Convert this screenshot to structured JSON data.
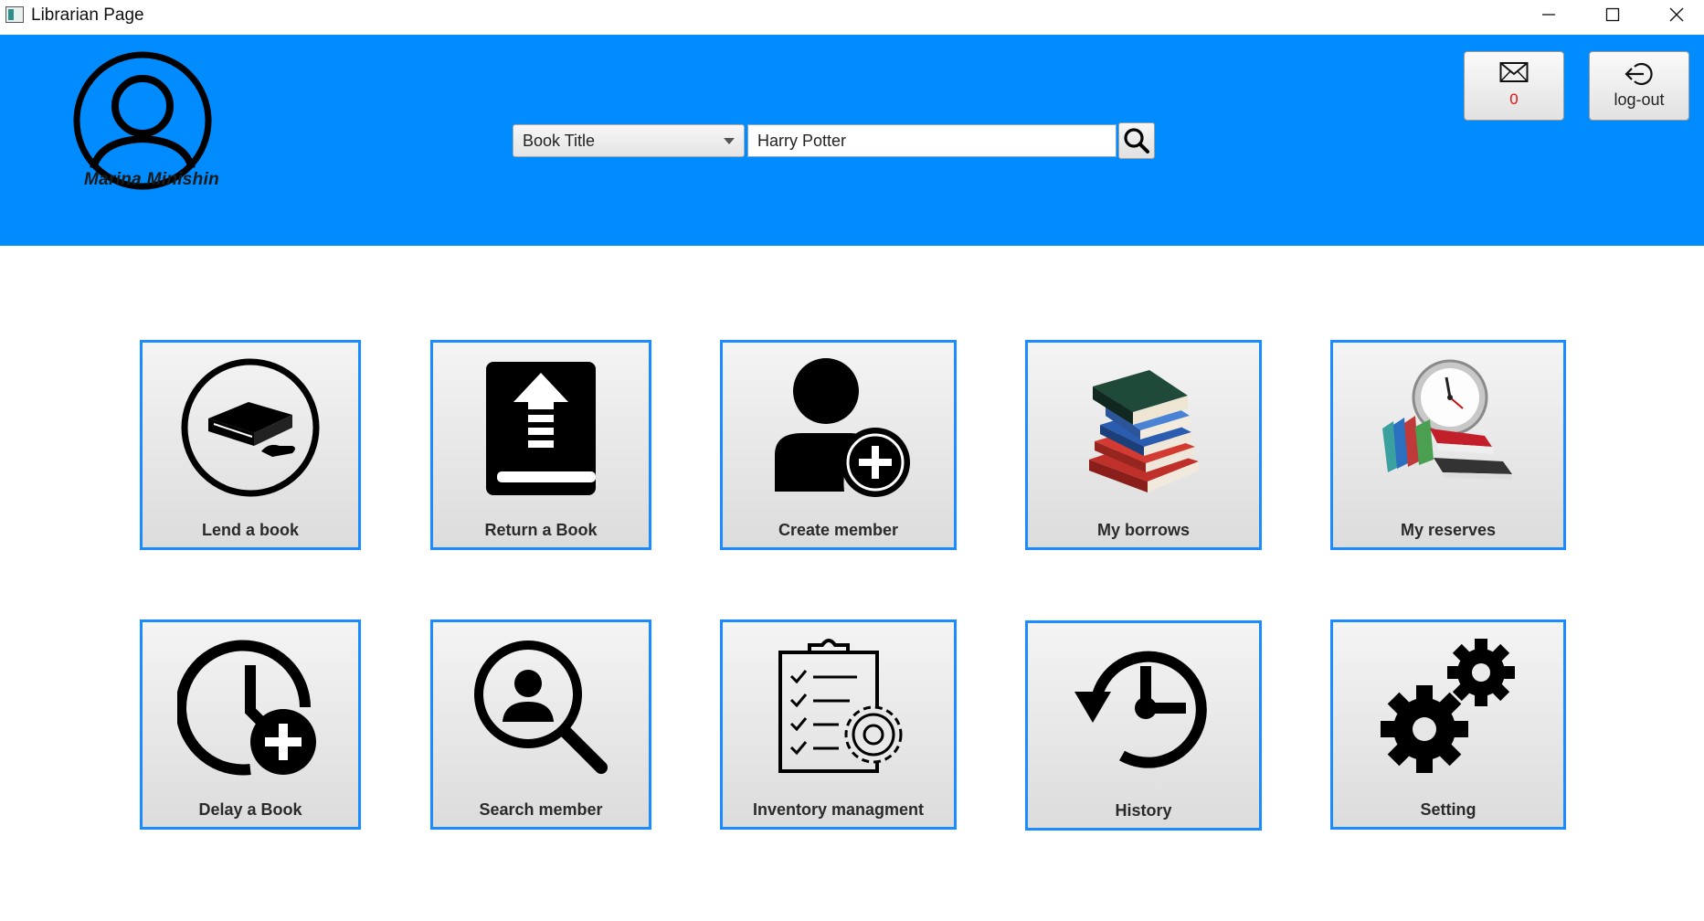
{
  "window": {
    "title": "Librarian Page"
  },
  "header": {
    "user_name": "Marina Minishin",
    "search": {
      "filter_selected": "Book Title",
      "query": "Harry Potter"
    },
    "messages": {
      "count": "0"
    },
    "logout_label": "log-out",
    "background_color": "#008bff"
  },
  "tiles": [
    {
      "label": "Lend a book",
      "icon": "lend-book-icon"
    },
    {
      "label": "Return a Book",
      "icon": "return-book-icon"
    },
    {
      "label": "Create member",
      "icon": "add-user-icon"
    },
    {
      "label": "My borrows",
      "icon": "book-stack-icon"
    },
    {
      "label": "My reserves",
      "icon": "clock-books-icon"
    },
    {
      "label": "Delay a Book",
      "icon": "clock-plus-icon"
    },
    {
      "label": "Search member",
      "icon": "search-user-icon"
    },
    {
      "label": "Inventory managment",
      "icon": "clipboard-gear-icon"
    },
    {
      "label": "History",
      "icon": "history-icon"
    },
    {
      "label": "Setting",
      "icon": "gears-icon"
    }
  ],
  "colors": {
    "accent": "#1a8cff",
    "message_count": "#e01010"
  }
}
